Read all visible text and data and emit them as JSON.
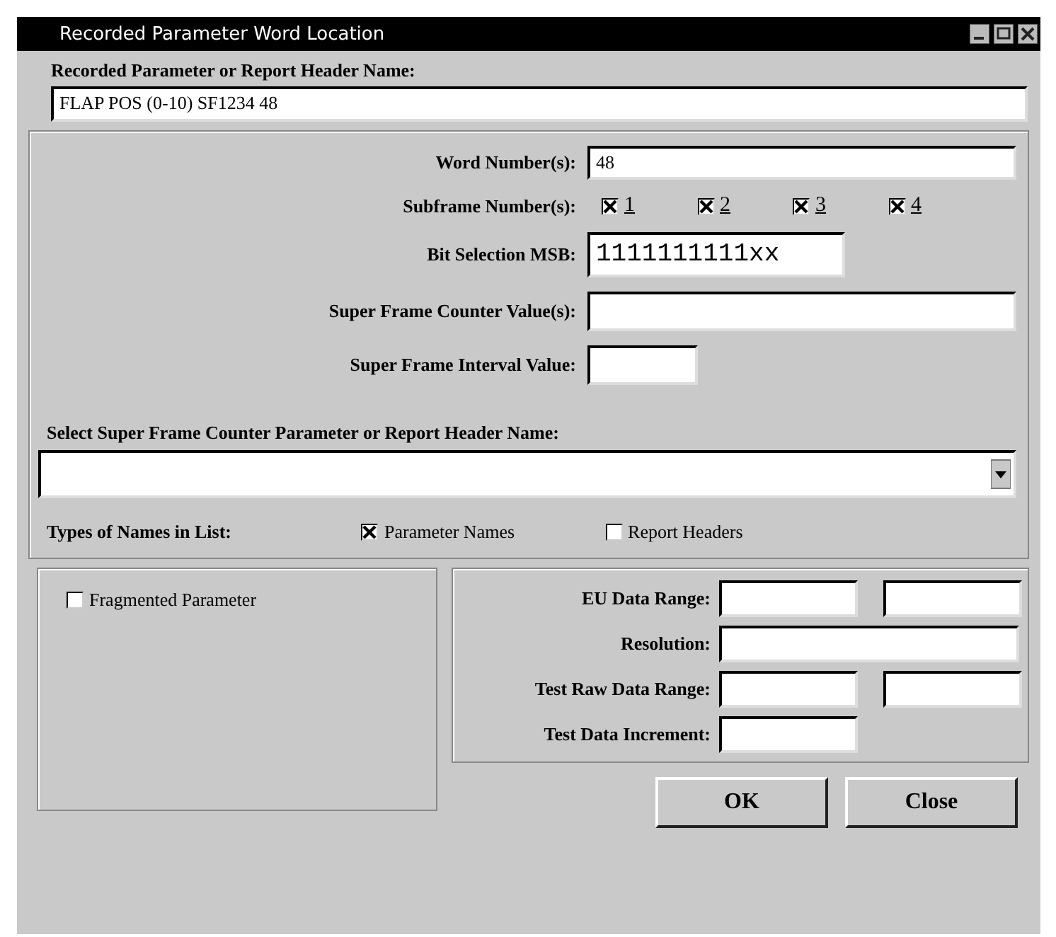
{
  "window": {
    "title": "Recorded Parameter Word Location"
  },
  "name_field": {
    "label": "Recorded Parameter or Report Header Name:",
    "value": "FLAP POS (0-10)  SF1234  48"
  },
  "word_numbers": {
    "label": "Word Number(s):",
    "value": "48"
  },
  "subframes": {
    "label": "Subframe Number(s):",
    "options": [
      {
        "label": "1",
        "checked": true
      },
      {
        "label": "2",
        "checked": true
      },
      {
        "label": "3",
        "checked": true
      },
      {
        "label": "4",
        "checked": true
      }
    ]
  },
  "bit_selection": {
    "label": "Bit Selection MSB:",
    "value": "1111111111xx"
  },
  "super_frame_counter": {
    "label": "Super Frame Counter Value(s):"
  },
  "super_frame_interval": {
    "label": "Super Frame Interval Value:"
  },
  "counter_select": {
    "label": "Select Super Frame Counter Parameter or Report Header Name:"
  },
  "name_types": {
    "label": "Types of Names in List:",
    "options": [
      {
        "label": "Parameter Names",
        "checked": true
      },
      {
        "label": "Report Headers",
        "checked": false
      }
    ]
  },
  "fragmented": {
    "label": "Fragmented Parameter",
    "checked": false
  },
  "ranges": [
    {
      "label": "EU Data Range:",
      "kind": "pair"
    },
    {
      "label": "Resolution:",
      "kind": "wide"
    },
    {
      "label": "Test Raw Data Range:",
      "kind": "pair"
    },
    {
      "label": "Test Data Increment:",
      "kind": "single"
    }
  ],
  "buttons": [
    {
      "label": "OK"
    },
    {
      "label": "Close"
    }
  ]
}
